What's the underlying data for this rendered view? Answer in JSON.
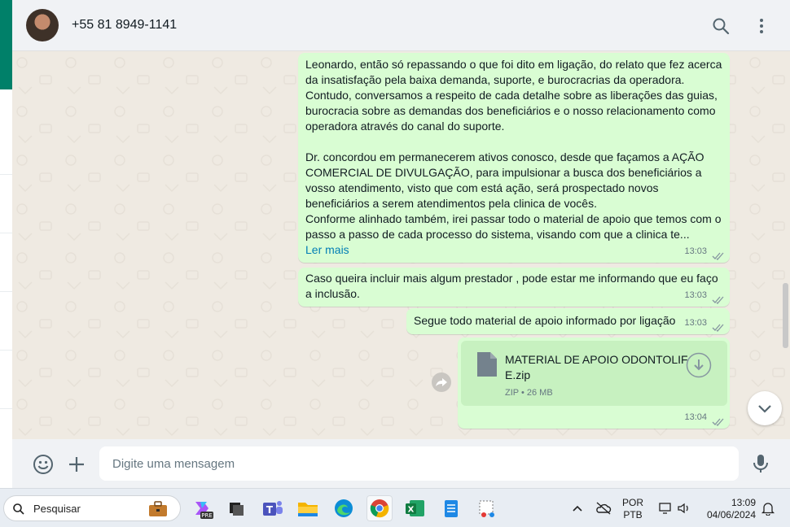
{
  "header": {
    "contact": "+55 81 8949-1141",
    "search_icon": "search-icon",
    "menu_icon": "kebab-menu-icon"
  },
  "messages": [
    {
      "text": "Leonardo, então só repassando o que foi dito em ligação, do relato que fez acerca da insatisfação pela baixa demanda, suporte, e burocracrias da operadora.\nContudo, conversamos a respeito de cada detalhe sobre as liberações das guias, burocracia sobre as demandas dos beneficiários e o nosso relacionamento como operadora através do canal do suporte.\n\nDr. concordou em permanecerem ativos conosco, desde que façamos a AÇÃO COMERCIAL DE DIVULGAÇÃO, para impulsionar a busca dos beneficiários a vosso atendimento, visto que com está ação, será prospectado novos beneficiários a serem atendimentos pela clinica de vocês.\nConforme alinhado também, irei passar todo o material de apoio que temos com o passo a passo de cada processo do sistema, visando com que a clinica te...",
      "read_more": "Ler mais",
      "time": "13:03"
    },
    {
      "text": "Caso queira incluir mais algum prestador , pode estar me informando que eu faço a inclusão.",
      "time": "13:03"
    },
    {
      "text": "Segue todo material de apoio informado por ligação",
      "time": "13:03"
    },
    {
      "file_name_line1": "MATERIAL DE APOIO ODONTOLIF",
      "file_name_line2": "E.zip",
      "file_meta": "ZIP • 26 MB",
      "time": "13:04"
    }
  ],
  "composer": {
    "placeholder": "Digite uma mensagem",
    "emoji_icon": "emoji-icon",
    "attach_icon": "plus-icon",
    "mic_icon": "microphone-icon"
  },
  "taskbar": {
    "search_label": "Pesquisar",
    "lang_line1": "POR",
    "lang_line2": "PTB",
    "time": "13:09",
    "date": "04/06/2024"
  },
  "colors": {
    "bubble_out": "#d9fdd3",
    "chat_bg": "#efeae2",
    "accent": "#008069",
    "link": "#027eb5"
  }
}
